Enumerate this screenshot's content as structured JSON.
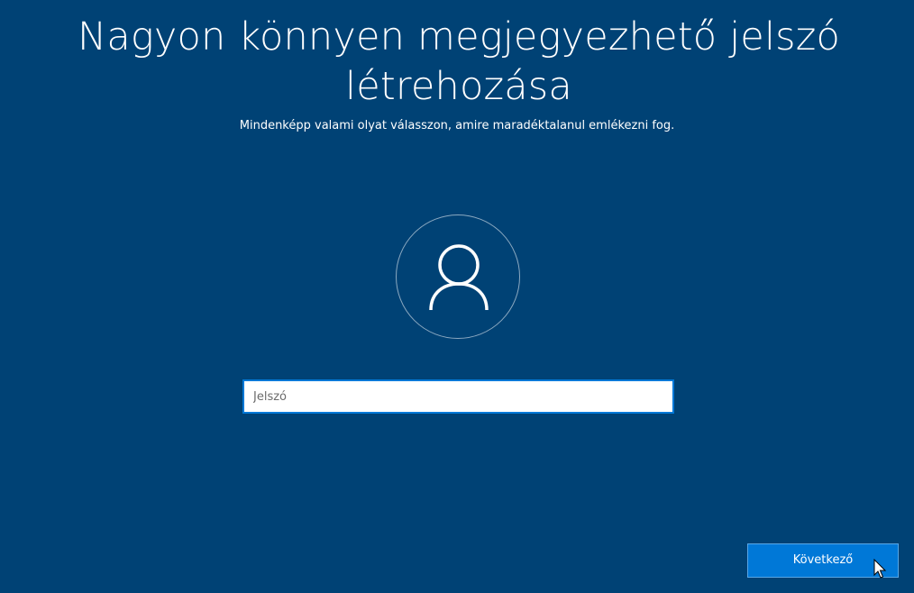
{
  "header": {
    "title": "Nagyon könnyen megjegyezhető jelszó létrehozása",
    "subtitle": "Mindenképp valami olyat válasszon, amire maradéktalanul emlékezni fog."
  },
  "avatar": {
    "icon": "user-icon"
  },
  "password": {
    "placeholder": "Jelszó",
    "value": ""
  },
  "footer": {
    "next_label": "Következő"
  },
  "colors": {
    "background": "#004275",
    "accent": "#0078d7",
    "text": "#ffffff"
  }
}
